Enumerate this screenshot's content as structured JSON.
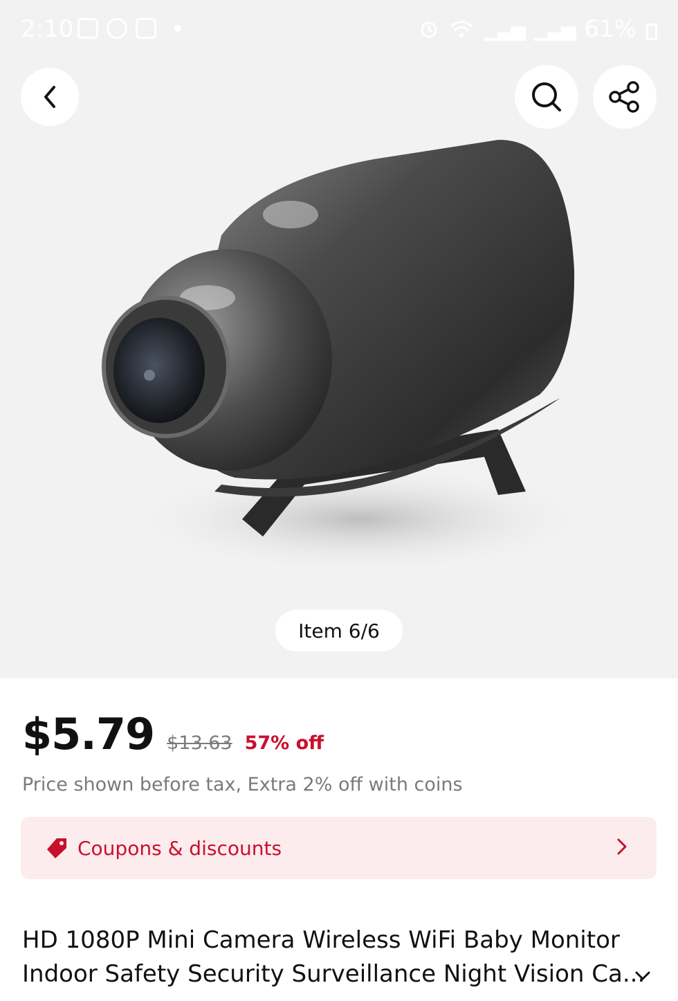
{
  "status_bar": {
    "time": "2:10",
    "left_icons": [
      "gallery-icon",
      "b-icon",
      "instagram-icon",
      "notification-dot"
    ],
    "right_icons": [
      "alarm-icon",
      "wifi-icon",
      "signal-icon",
      "signal-roaming-icon",
      "battery-icon"
    ],
    "battery": "61%"
  },
  "gallery": {
    "counter": "Item 6/6"
  },
  "price": {
    "current": "$5.79",
    "original": "$13.63",
    "discount": "57% off",
    "note": "Price shown before tax, Extra 2% off with coins"
  },
  "coupons": {
    "label": "Coupons & discounts"
  },
  "product": {
    "title_line1": "HD 1080P Mini Camera Wireless WiFi Baby Monitor",
    "title_line2": "Indoor Safety Security Surveillance Night Vision Ca..."
  },
  "colors": {
    "accent": "#c8102e",
    "coupon_bg": "#fdeced",
    "hero_bg": "#f2f2f2"
  }
}
